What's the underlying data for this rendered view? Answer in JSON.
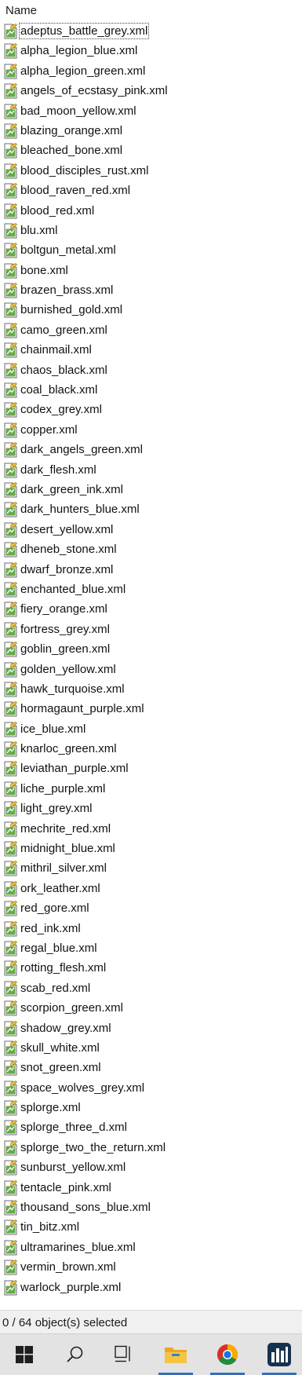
{
  "column_header": {
    "name_label": "Name"
  },
  "files": [
    "adeptus_battle_grey.xml",
    "alpha_legion_blue.xml",
    "alpha_legion_green.xml",
    "angels_of_ecstasy_pink.xml",
    "bad_moon_yellow.xml",
    "blazing_orange.xml",
    "bleached_bone.xml",
    "blood_disciples_rust.xml",
    "blood_raven_red.xml",
    "blood_red.xml",
    "blu.xml",
    "boltgun_metal.xml",
    "bone.xml",
    "brazen_brass.xml",
    "burnished_gold.xml",
    "camo_green.xml",
    "chainmail.xml",
    "chaos_black.xml",
    "coal_black.xml",
    "codex_grey.xml",
    "copper.xml",
    "dark_angels_green.xml",
    "dark_flesh.xml",
    "dark_green_ink.xml",
    "dark_hunters_blue.xml",
    "desert_yellow.xml",
    "dheneb_stone.xml",
    "dwarf_bronze.xml",
    "enchanted_blue.xml",
    "fiery_orange.xml",
    "fortress_grey.xml",
    "goblin_green.xml",
    "golden_yellow.xml",
    "hawk_turquoise.xml",
    "hormagaunt_purple.xml",
    "ice_blue.xml",
    "knarloc_green.xml",
    "leviathan_purple.xml",
    "liche_purple.xml",
    "light_grey.xml",
    "mechrite_red.xml",
    "midnight_blue.xml",
    "mithril_silver.xml",
    "ork_leather.xml",
    "red_gore.xml",
    "red_ink.xml",
    "regal_blue.xml",
    "rotting_flesh.xml",
    "scab_red.xml",
    "scorpion_green.xml",
    "shadow_grey.xml",
    "skull_white.xml",
    "snot_green.xml",
    "space_wolves_grey.xml",
    "splorge.xml",
    "splorge_three_d.xml",
    "splorge_two_the_return.xml",
    "sunburst_yellow.xml",
    "tentacle_pink.xml",
    "thousand_sons_blue.xml",
    "tin_bitz.xml",
    "ultramarines_blue.xml",
    "vermin_brown.xml",
    "warlock_purple.xml"
  ],
  "file_icon": "xml-document-icon",
  "status_bar": {
    "selection_text": "0 / 64 object(s) selected"
  },
  "taskbar": {
    "icons": [
      "windows-start-icon",
      "search-icon",
      "task-view-icon",
      "file-explorer-icon",
      "chrome-icon",
      "app-icon"
    ]
  },
  "colors": {
    "icon_green": "#6aa84f",
    "taskbar_bg": "#e3e3e3",
    "status_bar_bg": "#f0f0f0",
    "active_indicator": "#3a6db3"
  }
}
